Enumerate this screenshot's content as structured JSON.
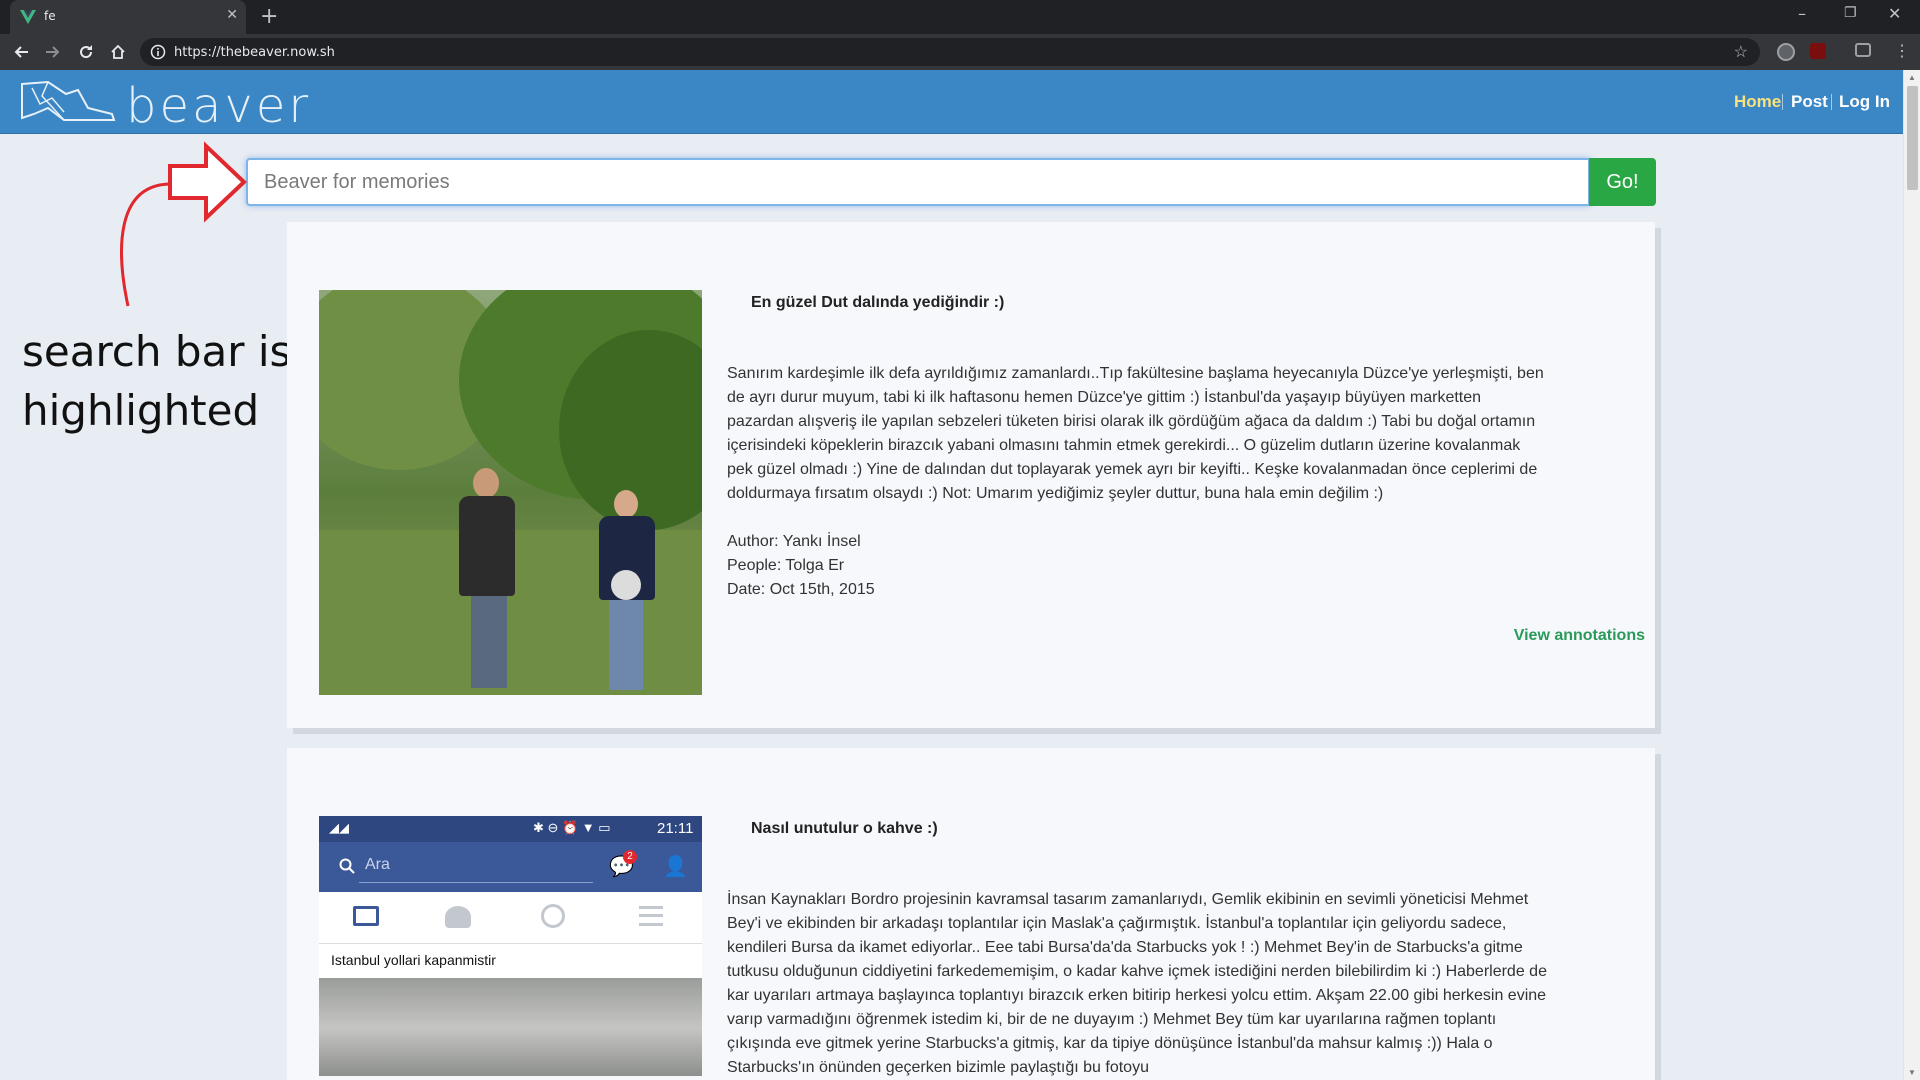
{
  "browser": {
    "tab_title": "fe",
    "url": "https://thebeaver.now.sh"
  },
  "site": {
    "logo_text": "beaver",
    "nav": {
      "home": "Home",
      "post": "Post",
      "login": "Log In"
    },
    "nav_active_color": "#f7e27b",
    "header_color": "#3b87c6"
  },
  "search": {
    "placeholder": "Beaver for memories",
    "value": "",
    "go_label": "Go!"
  },
  "annotation": {
    "text": "search bar is highlighted"
  },
  "cards": [
    {
      "title": "En güzel Dut dalında yediğindir :)",
      "body": "Sanırım kardeşimle ilk defa ayrıldığımız zamanlardı..Tıp fakültesine başlama heyecanıyla Düzce'ye yerleşmişti, ben de ayrı durur muyum, tabi ki ilk haftasonu hemen Düzce'ye gittim :) İstanbul'da yaşayıp büyüyen marketten pazardan alışveriş ile yapılan sebzeleri tüketen birisi olarak ilk gördüğüm ağaca da daldım :) Tabi bu doğal ortamın içerisindeki köpeklerin birazcık yabani olmasını tahmin etmek gerekirdi... O güzelim dutların üzerine kovalanmak pek güzel olmadı :) Yine de dalından dut toplayarak yemek ayrı bir keyifti.. Keşke kovalanmadan önce ceplerimi de doldurmaya fırsatım olsaydı :) Not: Umarım yediğimiz şeyler duttur, buna hala emin değilim :)",
      "author": "Author: Yankı İnsel",
      "people": "People: Tolga Er",
      "date": "Date: Oct 15th, 2015",
      "link": "View annotations"
    },
    {
      "title": "Nasıl unutulur o kahve :)",
      "body": "İnsan Kaynakları Bordro projesinin kavramsal tasarım zamanlarıydı, Gemlik ekibinin en sevimli yöneticisi Mehmet Bey'i ve ekibinden bir arkadaşı toplantılar için Maslak'a çağırmıştık. İstanbul'a toplantılar için geliyordu sadece, kendileri Bursa da ikamet ediyorlar.. Eee tabi Bursa'da'da Starbucks yok ! :) Mehmet Bey'in de Starbucks'a gitme tutkusu olduğunun ciddiyetini farkedememişim, o kadar kahve içmek istediğini nerden bilebilirdim ki :) Haberlerde de kar uyarıları artmaya başlayınca toplantıyı birazcık erken bitirip herkesi yolcu ettim. Akşam 22.00 gibi herkesin evine varıp varmadığını öğrenmek istedim ki, bir de ne duyayım :) Mehmet Bey tüm kar uyarılarına rağmen toplantı çıkışında eve gitmek yerine Starbucks'a gitmiş, kar da tipiye dönüşünce İstanbul'da mahsur kalmış :)) Hala o Starbucks'ın önünden geçerken bizimle paylaştığı bu fotoyu",
      "phone": {
        "time": "21:11",
        "search_placeholder": "Ara",
        "badge": "2",
        "caption": "Istanbul yollari kapanmistir"
      }
    }
  ]
}
